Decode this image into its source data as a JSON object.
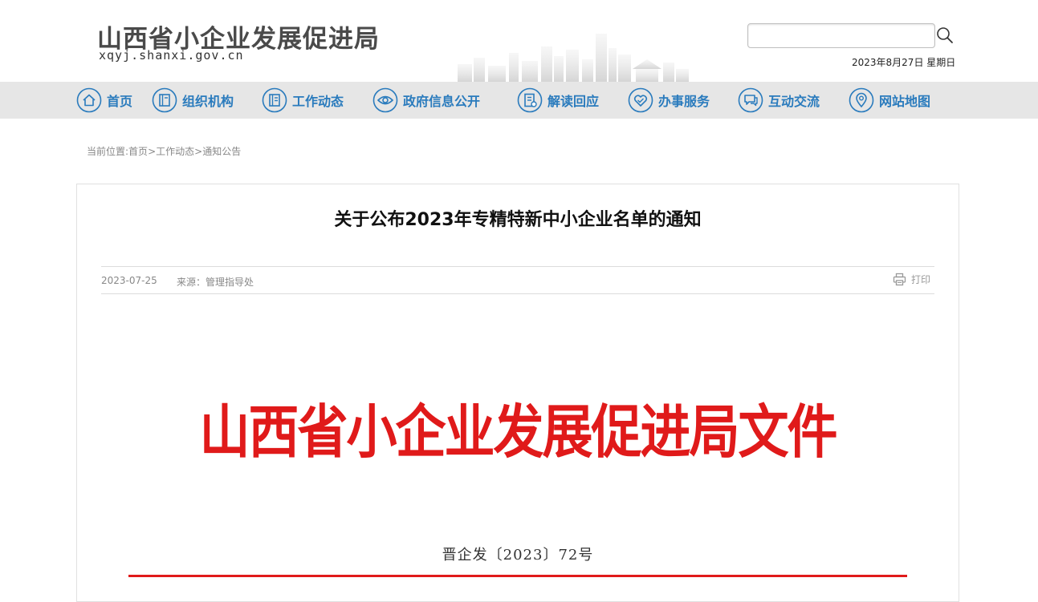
{
  "header": {
    "site_title": "山西省小企业发展促进局",
    "domain": "xqyj.shanxi.gov.cn",
    "date": "2023年8月27日 星期日",
    "search": {
      "placeholder": ""
    }
  },
  "nav": {
    "items": [
      {
        "label": "首页",
        "icon": "home-icon"
      },
      {
        "label": "组织机构",
        "icon": "organization-icon"
      },
      {
        "label": "工作动态",
        "icon": "news-icon"
      },
      {
        "label": "政府信息公开",
        "icon": "eye-icon"
      },
      {
        "label": "解读回应",
        "icon": "document-icon"
      },
      {
        "label": "办事服务",
        "icon": "handshake-icon"
      },
      {
        "label": "互动交流",
        "icon": "chat-icon"
      },
      {
        "label": "网站地图",
        "icon": "location-icon"
      }
    ]
  },
  "breadcrumb": {
    "prefix": "当前位置:",
    "items": [
      "首页",
      "工作动态",
      "通知公告"
    ],
    "separator": ">"
  },
  "article": {
    "title": "关于公布2023年专精特新中小企业名单的通知",
    "date": "2023-07-25",
    "source": "来源：管理指导处",
    "print_label": "打印",
    "doc_header": "山西省小企业发展促进局文件",
    "doc_number": "晋企发〔2023〕72号"
  },
  "colors": {
    "nav_text": "#2a7bbd",
    "nav_bg": "#e6e6e6",
    "doc_red": "#e01a1a"
  }
}
